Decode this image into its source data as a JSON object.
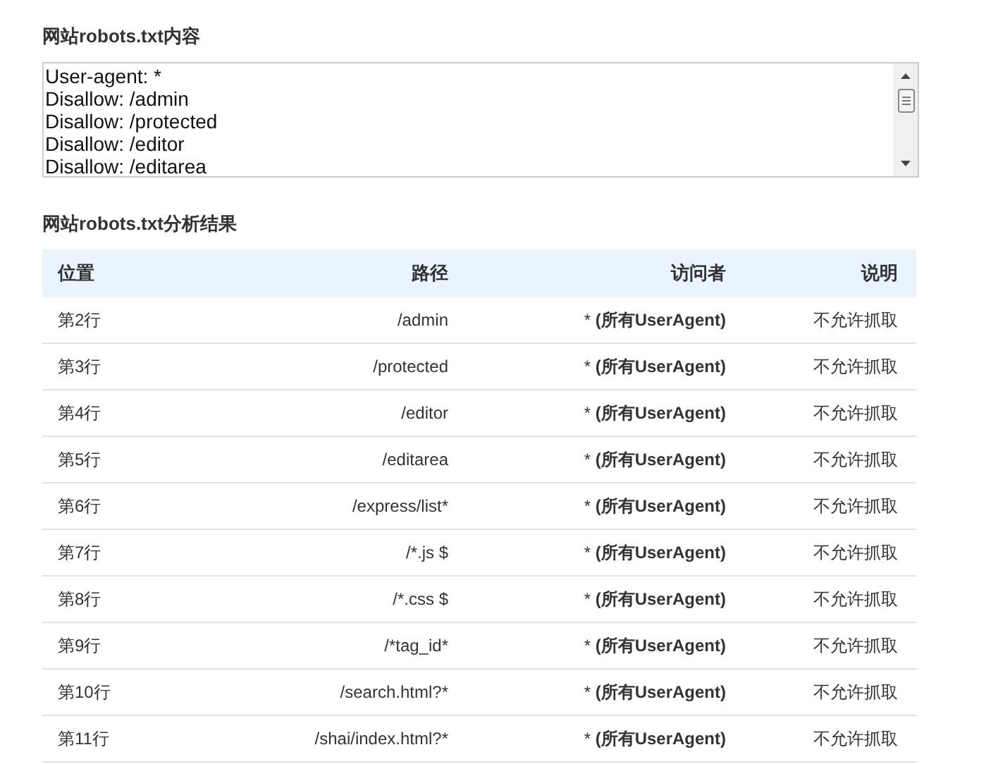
{
  "robots_section": {
    "title": "网站robots.txt内容",
    "lines": [
      "User-agent: *",
      "Disallow: /admin",
      "Disallow: /protected",
      "Disallow: /editor",
      "Disallow: /editarea"
    ]
  },
  "analysis_section": {
    "title": "网站robots.txt分析结果",
    "table": {
      "columns": [
        "位置",
        "路径",
        "访问者",
        "说明"
      ],
      "rows": [
        {
          "position": "第2行",
          "path": "/admin",
          "visitor": "* **(所有UserAgent)**",
          "note": "不允许抓取"
        },
        {
          "position": "第3行",
          "path": "/protected",
          "visitor": "* **(所有UserAgent)**",
          "note": "不允许抓取"
        },
        {
          "position": "第4行",
          "path": "/editor",
          "visitor": "* **(所有UserAgent)**",
          "note": "不允许抓取"
        },
        {
          "position": "第5行",
          "path": "/editarea",
          "visitor": "* **(所有UserAgent)**",
          "note": "不允许抓取"
        },
        {
          "position": "第6行",
          "path": "/express/list*",
          "visitor": "* **(所有UserAgent)**",
          "note": "不允许抓取"
        },
        {
          "position": "第7行",
          "path": "/*.js $",
          "visitor": "* **(所有UserAgent)**",
          "note": "不允许抓取"
        },
        {
          "position": "第8行",
          "path": "/*.css $",
          "visitor": "* **(所有UserAgent)**",
          "note": "不允许抓取"
        },
        {
          "position": "第9行",
          "path": "/*tag_id*",
          "visitor": "* **(所有UserAgent)**",
          "note": "不允许抓取"
        },
        {
          "position": "第10行",
          "path": "/search.html?*",
          "visitor": "* **(所有UserAgent)**",
          "note": "不允许抓取"
        },
        {
          "position": "第11行",
          "path": "/shai/index.html?*",
          "visitor": "* **(所有UserAgent)**",
          "note": "不允许抓取"
        }
      ]
    }
  }
}
